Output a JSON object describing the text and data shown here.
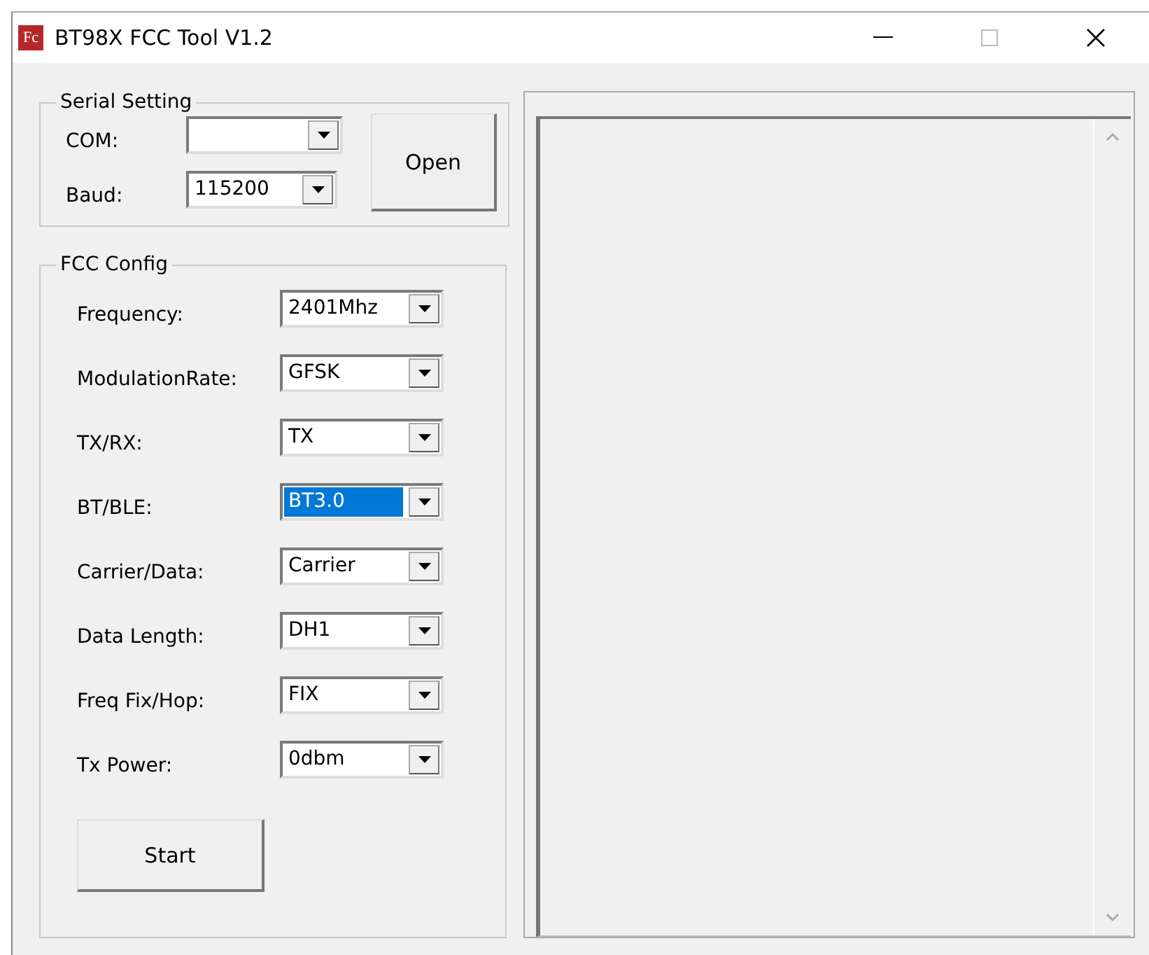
{
  "window": {
    "icon_text": "Fc",
    "title": "BT98X FCC Tool V1.2",
    "maximize_disabled": true
  },
  "serial_setting": {
    "title": "Serial Setting",
    "fields": [
      {
        "label": "COM:"
      },
      {
        "label": "Baud:",
        "value": "115200"
      }
    ],
    "button": "Open"
  },
  "fcc_config": {
    "title": "FCC Config",
    "fields": [
      {
        "label": "Frequency:",
        "value": "2401Mhz",
        "highlighted": false
      },
      {
        "label": "ModulationRate:",
        "value": "GFSK",
        "highlighted": false
      },
      {
        "label": "TX/RX:",
        "value": "TX",
        "highlighted": false
      },
      {
        "label": "BT/BLE:",
        "value": "BT3.0",
        "highlighted": true
      },
      {
        "label": "Carrier/Data:",
        "value": "Carrier",
        "highlighted": false
      },
      {
        "label": "Data Length:",
        "value": "DH1",
        "highlighted": false
      },
      {
        "label": "Freq Fix/Hop:",
        "value": "FIX",
        "highlighted": false
      },
      {
        "label": "Tx Power:",
        "value": "0dbm",
        "highlighted": false
      }
    ],
    "button": "Start"
  }
}
